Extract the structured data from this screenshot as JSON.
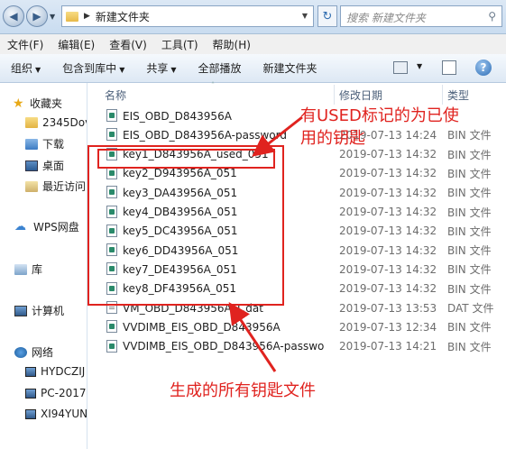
{
  "address": {
    "path_label": "新建文件夹",
    "search_placeholder": "搜索 新建文件夹"
  },
  "menu": {
    "items": [
      "文件(F)",
      "编辑(E)",
      "查看(V)",
      "工具(T)",
      "帮助(H)"
    ]
  },
  "toolbar": {
    "organize": "组织",
    "include": "包含到库中",
    "share": "共享",
    "play_all": "全部播放",
    "new_folder": "新建文件夹"
  },
  "nav": {
    "favorites": "收藏夹",
    "items": [
      {
        "label": "2345Dov",
        "icon": "folder-icon"
      },
      {
        "label": "下载",
        "icon": "downloads-icon"
      },
      {
        "label": "桌面",
        "icon": "desktop-icon"
      },
      {
        "label": "最近访问",
        "icon": "recent-places-icon"
      }
    ],
    "wps": "WPS网盘",
    "library": "库",
    "computer": "计算机",
    "network": "网络",
    "hosts": [
      "HYDCZIJ",
      "PC-2017",
      "XI94YUN"
    ]
  },
  "columns": {
    "name": "名称",
    "date": "修改日期",
    "type": "类型"
  },
  "files": [
    {
      "name": "EIS_OBD_D843956A",
      "date": "",
      "type": "",
      "icon": "bin"
    },
    {
      "name": "EIS_OBD_D843956A-password",
      "date": "2019-07-13 14:24",
      "type": "BIN 文件",
      "icon": "bin"
    },
    {
      "name": "key1_D843956A_used_051",
      "date": "2019-07-13 14:32",
      "type": "BIN 文件",
      "icon": "bin"
    },
    {
      "name": "key2_D943956A_051",
      "date": "2019-07-13 14:32",
      "type": "BIN 文件",
      "icon": "bin"
    },
    {
      "name": "key3_DA43956A_051",
      "date": "2019-07-13 14:32",
      "type": "BIN 文件",
      "icon": "bin"
    },
    {
      "name": "key4_DB43956A_051",
      "date": "2019-07-13 14:32",
      "type": "BIN 文件",
      "icon": "bin"
    },
    {
      "name": "key5_DC43956A_051",
      "date": "2019-07-13 14:32",
      "type": "BIN 文件",
      "icon": "bin"
    },
    {
      "name": "key6_DD43956A_051",
      "date": "2019-07-13 14:32",
      "type": "BIN 文件",
      "icon": "bin"
    },
    {
      "name": "key7_DE43956A_051",
      "date": "2019-07-13 14:32",
      "type": "BIN 文件",
      "icon": "bin"
    },
    {
      "name": "key8_DF43956A_051",
      "date": "2019-07-13 14:32",
      "type": "BIN 文件",
      "icon": "bin"
    },
    {
      "name": "VM_OBD_D843956A-1.dat",
      "date": "2019-07-13 13:53",
      "type": "DAT 文件",
      "icon": "dat"
    },
    {
      "name": "VVDIMB_EIS_OBD_D843956A",
      "date": "2019-07-13 12:34",
      "type": "BIN 文件",
      "icon": "bin"
    },
    {
      "name": "VVDIMB_EIS_OBD_D843956A-passwo",
      "date": "2019-07-13 14:21",
      "type": "BIN 文件",
      "icon": "bin"
    }
  ],
  "annotations": {
    "used_note_line1": "有USED标记的为已使",
    "used_note_line2": "用的钥匙",
    "all_keys_note": "生成的所有钥匙文件",
    "color": "#e0231f"
  }
}
